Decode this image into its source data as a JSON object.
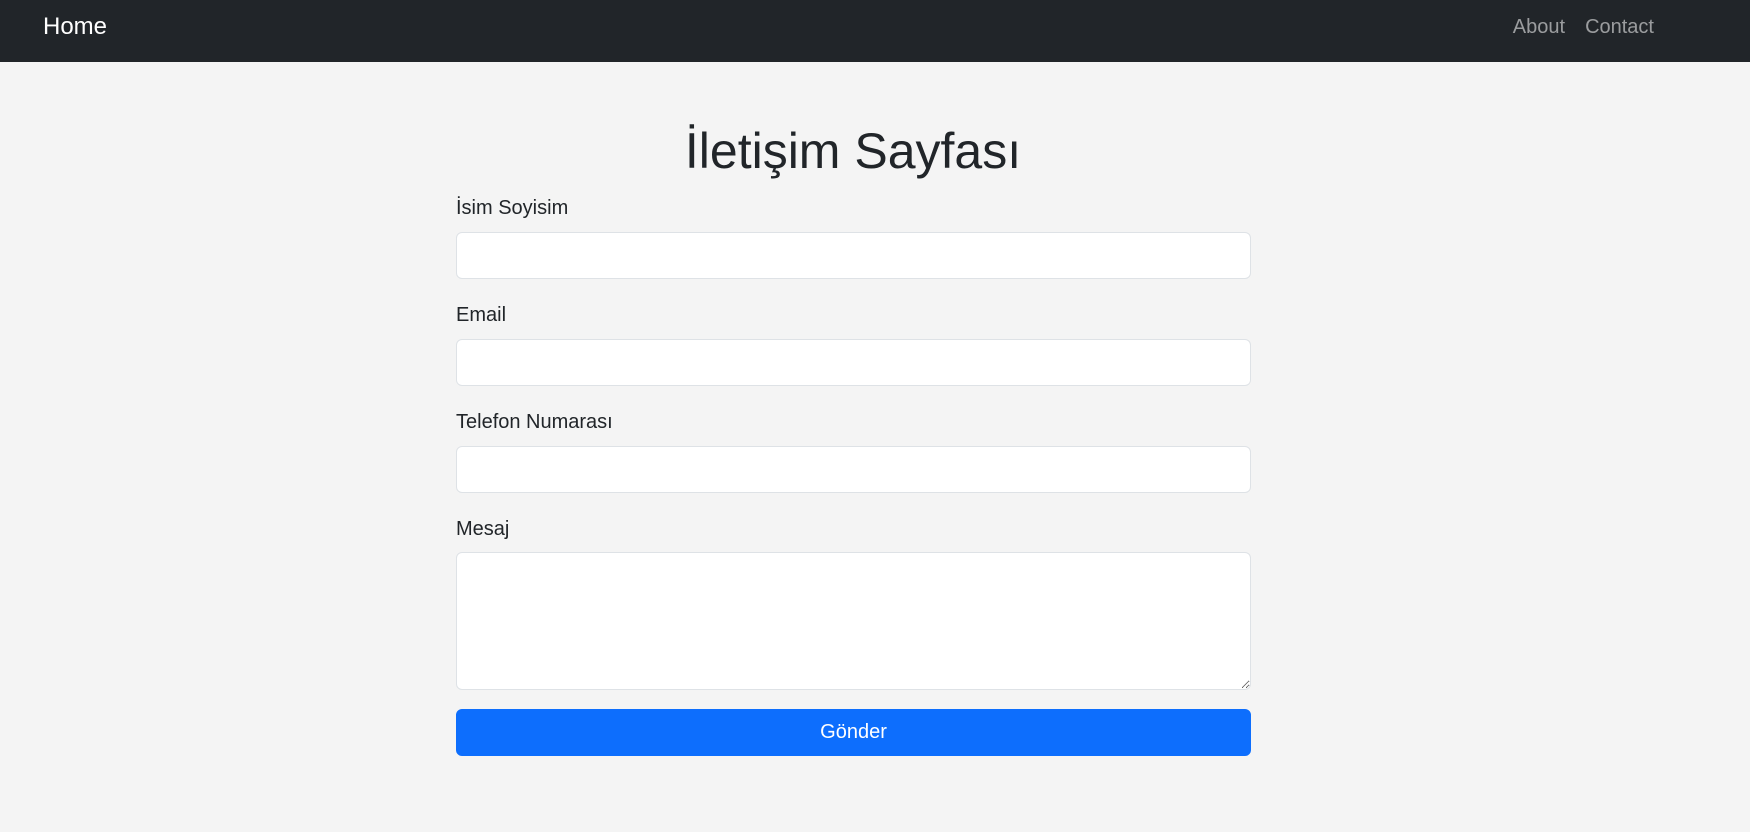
{
  "navbar": {
    "brand": "Home",
    "links": [
      "About",
      "Contact"
    ]
  },
  "page": {
    "title": "İletişim Sayfası"
  },
  "form": {
    "name_label": "İsim Soyisim",
    "name_value": "",
    "email_label": "Email",
    "email_value": "",
    "phone_label": "Telefon Numarası",
    "phone_value": "",
    "message_label": "Mesaj",
    "message_value": "",
    "submit_label": "Gönder"
  },
  "colors": {
    "navbar_bg": "#212529",
    "page_bg": "#f4f4f4",
    "primary": "#0d6efd"
  }
}
